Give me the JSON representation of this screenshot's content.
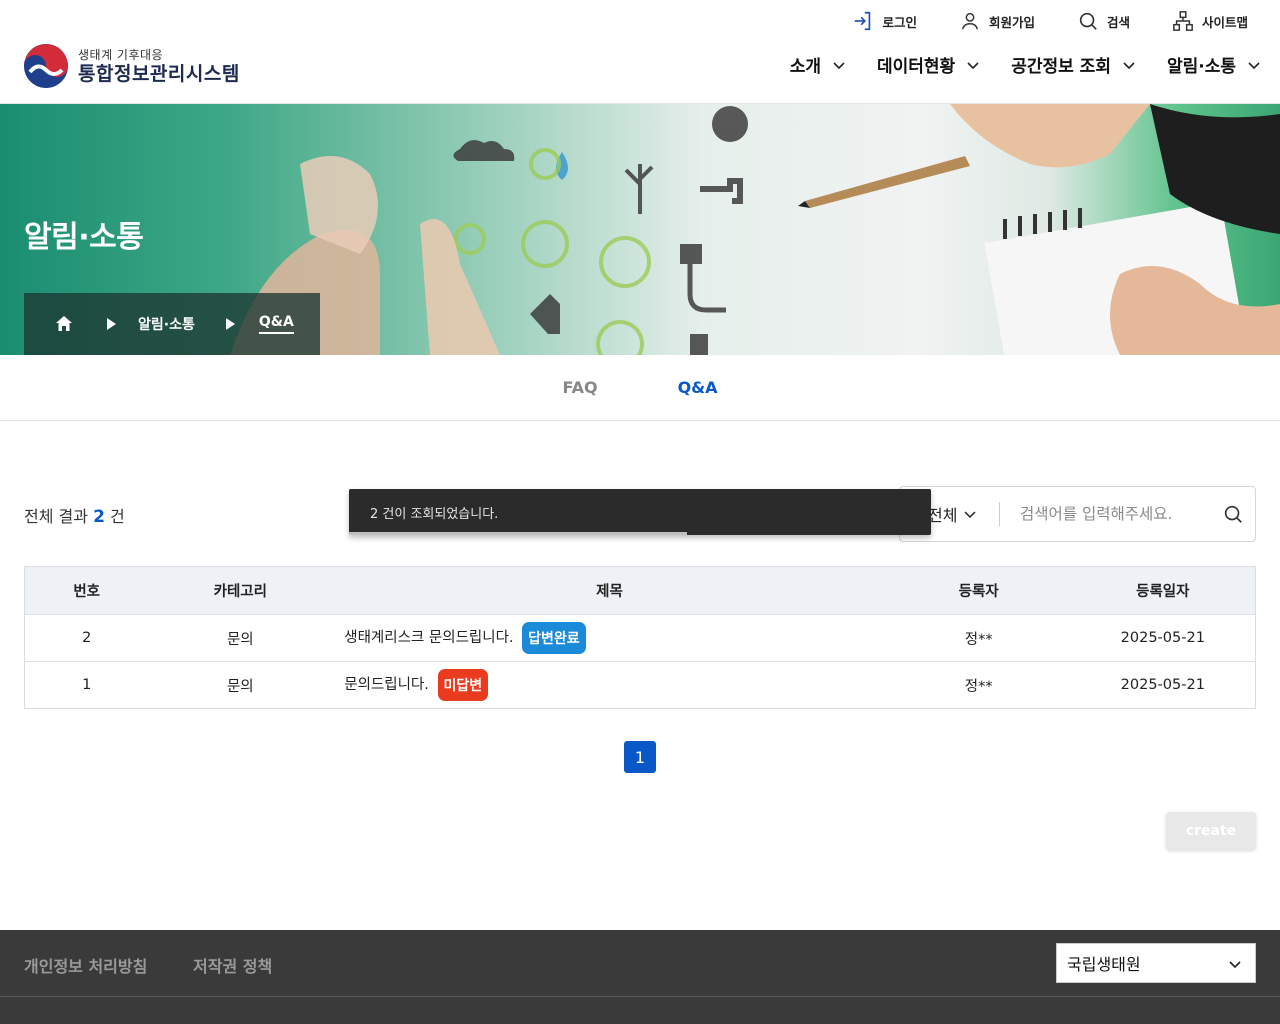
{
  "util": {
    "login": "로그인",
    "signup": "회원가입",
    "search": "검색",
    "sitemap": "사이트맵"
  },
  "logo": {
    "sub": "생태계 기후대응",
    "main": "통합정보관리시스템"
  },
  "gnb": [
    "소개",
    "데이터현황",
    "공간정보 조회",
    "알림·소통"
  ],
  "hero": {
    "title": "알림·소통",
    "breadcrumb": [
      "알림·소통",
      "Q&A"
    ]
  },
  "tabs": [
    {
      "label": "FAQ",
      "active": false
    },
    {
      "label": "Q&A",
      "active": true
    }
  ],
  "result": {
    "prefix": "전체 결과",
    "count": "2",
    "suffix": "건"
  },
  "toast": {
    "message": "2 건이 조회되었습니다.",
    "progress_pct": 58
  },
  "search": {
    "select_value": "전체",
    "placeholder": "검색어를 입력해주세요."
  },
  "table": {
    "headers": [
      "번호",
      "카테고리",
      "제목",
      "등록자",
      "등록일자"
    ],
    "rows": [
      {
        "no": "2",
        "category": "문의",
        "title": "생태계리스크 문의드립니다.",
        "badge": "답변완료",
        "badge_type": "done",
        "writer": "정**",
        "date": "2025-05-21"
      },
      {
        "no": "1",
        "category": "문의",
        "title": "문의드립니다.",
        "badge": "미답변",
        "badge_type": "wait",
        "writer": "정**",
        "date": "2025-05-21"
      }
    ]
  },
  "pagination": {
    "current": "1"
  },
  "create_label": "create",
  "footer": {
    "privacy": "개인정보 처리방침",
    "copyright": "저작권 정책",
    "site_select": "국립생태원"
  },
  "colors": {
    "accent": "#0a58c8",
    "badge_done": "#1a8ad9",
    "badge_wait": "#ea3b1f",
    "footer_bg": "#3a3a3a"
  }
}
